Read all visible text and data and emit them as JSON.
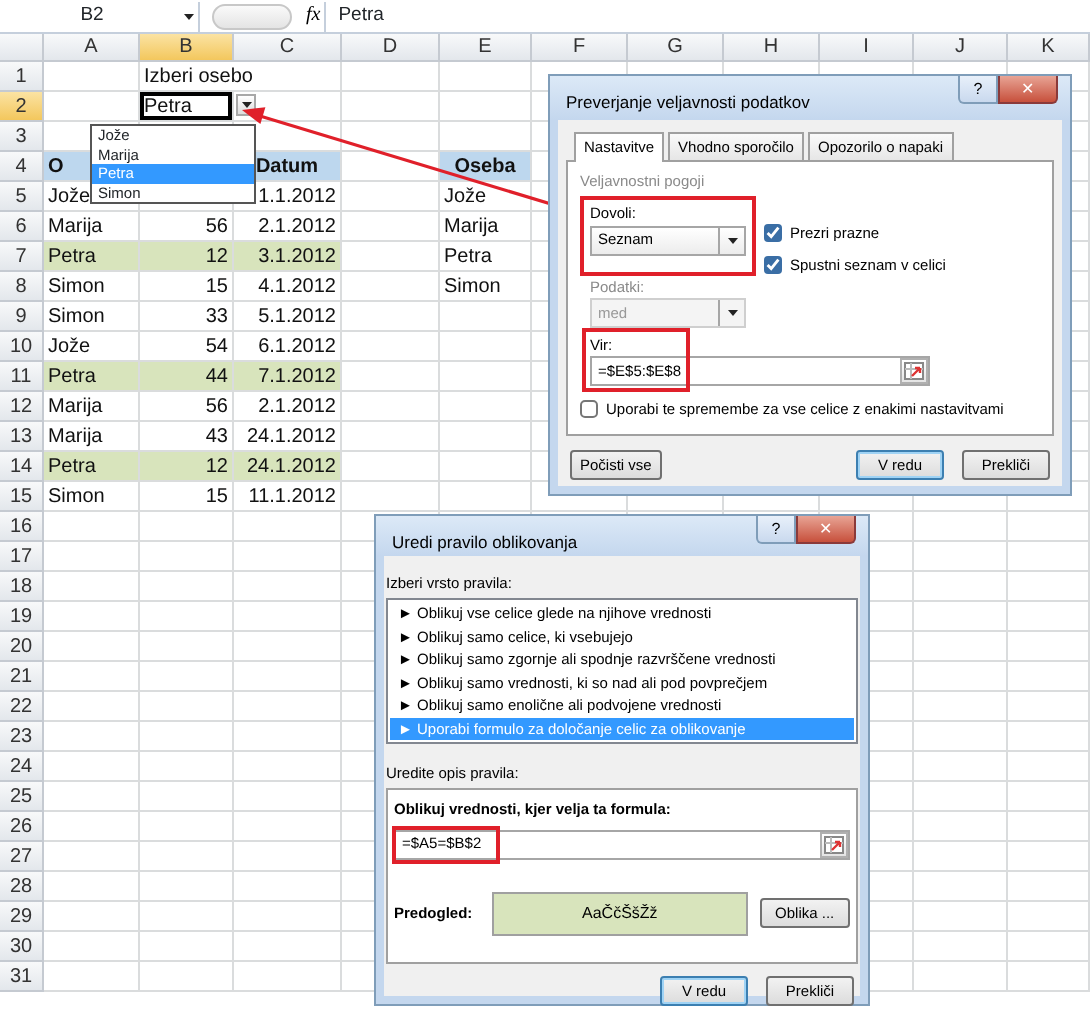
{
  "formula_bar": {
    "name_box": "B2",
    "function_label": "fx",
    "formula": "Petra"
  },
  "columns": [
    {
      "label": "A",
      "selected": false
    },
    {
      "label": "B",
      "selected": true
    },
    {
      "label": "C",
      "selected": false
    },
    {
      "label": "D",
      "selected": false
    },
    {
      "label": "E",
      "selected": false
    },
    {
      "label": "F",
      "selected": false
    },
    {
      "label": "G",
      "selected": false
    },
    {
      "label": "H",
      "selected": false
    },
    {
      "label": "I",
      "selected": false
    },
    {
      "label": "J",
      "selected": false
    },
    {
      "label": "K",
      "selected": false
    }
  ],
  "rows": [
    {
      "number": "1",
      "selected": false,
      "kind": "data",
      "highlighted": false,
      "cells": {
        "b": "Izberi osebo"
      }
    },
    {
      "number": "2",
      "selected": true,
      "kind": "data",
      "highlighted": false,
      "cells": {
        "b": "Petra"
      }
    },
    {
      "number": "3",
      "selected": false,
      "kind": "data",
      "highlighted": false
    },
    {
      "number": "4",
      "selected": false,
      "kind": "header",
      "highlighted": false,
      "cells": {
        "a": "O",
        "c": "Datum",
        "e": "Oseba"
      }
    },
    {
      "number": "5",
      "selected": false,
      "kind": "data",
      "highlighted": false,
      "cells": {
        "a": "Jože",
        "c": "1.1.2012",
        "e": "Jože"
      }
    },
    {
      "number": "6",
      "selected": false,
      "kind": "data",
      "highlighted": false,
      "cells": {
        "a": "Marija",
        "b": "56",
        "c": "2.1.2012",
        "e": "Marija"
      }
    },
    {
      "number": "7",
      "selected": false,
      "kind": "data",
      "highlighted": true,
      "cells": {
        "a": "Petra",
        "b": "12",
        "c": "3.1.2012",
        "e": "Petra"
      }
    },
    {
      "number": "8",
      "selected": false,
      "kind": "data",
      "highlighted": false,
      "cells": {
        "a": "Simon",
        "b": "15",
        "c": "4.1.2012",
        "e": "Simon"
      }
    },
    {
      "number": "9",
      "selected": false,
      "kind": "data",
      "highlighted": false,
      "cells": {
        "a": "Simon",
        "b": "33",
        "c": "5.1.2012"
      }
    },
    {
      "number": "10",
      "selected": false,
      "kind": "data",
      "highlighted": false,
      "cells": {
        "a": "Jože",
        "b": "54",
        "c": "6.1.2012"
      }
    },
    {
      "number": "11",
      "selected": false,
      "kind": "data",
      "highlighted": true,
      "cells": {
        "a": "Petra",
        "b": "44",
        "c": "7.1.2012"
      }
    },
    {
      "number": "12",
      "selected": false,
      "kind": "data",
      "highlighted": false,
      "cells": {
        "a": "Marija",
        "b": "56",
        "c": "2.1.2012"
      }
    },
    {
      "number": "13",
      "selected": false,
      "kind": "data",
      "highlighted": false,
      "cells": {
        "a": "Marija",
        "b": "43",
        "c": "24.1.2012"
      }
    },
    {
      "number": "14",
      "selected": false,
      "kind": "data",
      "highlighted": true,
      "cells": {
        "a": "Petra",
        "b": "12",
        "c": "24.1.2012"
      }
    },
    {
      "number": "15",
      "selected": false,
      "kind": "data",
      "highlighted": false,
      "cells": {
        "a": "Simon",
        "b": "15",
        "c": "11.1.2012"
      }
    },
    {
      "number": "16",
      "selected": false,
      "kind": "data",
      "highlighted": false
    },
    {
      "number": "17",
      "selected": false,
      "kind": "data",
      "highlighted": false
    },
    {
      "number": "18",
      "selected": false,
      "kind": "data",
      "highlighted": false
    },
    {
      "number": "19",
      "selected": false,
      "kind": "data",
      "highlighted": false
    },
    {
      "number": "20",
      "selected": false,
      "kind": "data",
      "highlighted": false
    },
    {
      "number": "21",
      "selected": false,
      "kind": "data",
      "highlighted": false
    },
    {
      "number": "22",
      "selected": false,
      "kind": "data",
      "highlighted": false
    },
    {
      "number": "23",
      "selected": false,
      "kind": "data",
      "highlighted": false
    },
    {
      "number": "24",
      "selected": false,
      "kind": "data",
      "highlighted": false
    },
    {
      "number": "25",
      "selected": false,
      "kind": "data",
      "highlighted": false
    },
    {
      "number": "26",
      "selected": false,
      "kind": "data",
      "highlighted": false
    },
    {
      "number": "27",
      "selected": false,
      "kind": "data",
      "highlighted": false
    },
    {
      "number": "28",
      "selected": false,
      "kind": "data",
      "highlighted": false
    },
    {
      "number": "29",
      "selected": false,
      "kind": "data",
      "highlighted": false
    },
    {
      "number": "30",
      "selected": false,
      "kind": "data",
      "highlighted": false
    },
    {
      "number": "31",
      "selected": false,
      "kind": "data",
      "highlighted": false
    }
  ],
  "cell_dropdown": {
    "items": [
      {
        "label": "Jože",
        "selected": false
      },
      {
        "label": "Marija",
        "selected": false
      },
      {
        "label": "Petra",
        "selected": true
      },
      {
        "label": "Simon",
        "selected": false
      }
    ]
  },
  "validation_dialog": {
    "title": "Preverjanje veljavnosti podatkov",
    "help_glyph": "?",
    "close_glyph": "✕",
    "tabs": [
      {
        "label": "Nastavitve",
        "selected": true
      },
      {
        "label": "Vhodno sporočilo",
        "selected": false
      },
      {
        "label": "Opozorilo o napaki",
        "selected": false
      }
    ],
    "group_label": "Veljavnostni pogoji",
    "allow": {
      "label": "Dovoli:",
      "value": "Seznam",
      "highlighted": true,
      "disabled": false
    },
    "checkboxes": [
      {
        "label": "Prezri prazne",
        "checked": true
      },
      {
        "label": "Spustni seznam v celici",
        "checked": true
      }
    ],
    "data": {
      "label": "Podatki:",
      "value": "med",
      "disabled": true
    },
    "source": {
      "label": "Vir:",
      "value": "=$E$5:$E$8",
      "highlighted": true
    },
    "apply_all": {
      "label": "Uporabi te spremembe za vse celice z enakimi nastavitvami",
      "checked": false
    },
    "buttons": [
      {
        "label": "Počisti vse",
        "kind": "left",
        "default": false
      },
      {
        "label": "V redu",
        "kind": "right",
        "default": true
      },
      {
        "label": "Prekliči",
        "kind": "right",
        "default": false
      }
    ]
  },
  "rule_dialog": {
    "title": "Uredi pravilo oblikovanja",
    "help_glyph": "?",
    "close_glyph": "✕",
    "rule_type_label": "Izberi vrsto pravila:",
    "rule_types": [
      {
        "label": "► Oblikuj vse celice glede na njihove vrednosti",
        "selected": false
      },
      {
        "label": "► Oblikuj samo celice, ki vsebujejo",
        "selected": false
      },
      {
        "label": "► Oblikuj samo zgornje ali spodnje razvrščene vrednosti",
        "selected": false
      },
      {
        "label": "► Oblikuj samo vrednosti, ki so nad ali pod povprečjem",
        "selected": false
      },
      {
        "label": "► Oblikuj samo enolične ali podvojene vrednosti",
        "selected": false
      },
      {
        "label": "► Uporabi formulo za določanje celic za oblikovanje",
        "selected": true
      }
    ],
    "description_label": "Uredite opis pravila:",
    "formula_label": "Oblikuj vrednosti, kjer velja ta formula:",
    "formula": {
      "value": "=$A5=$B$2",
      "highlighted": true
    },
    "preview_label": "Predogled:",
    "preview_text": "AaČčŠšŽž",
    "format_button": "Oblika ...",
    "buttons": [
      {
        "label": "V redu",
        "default": true
      },
      {
        "label": "Prekliči",
        "default": false
      }
    ]
  }
}
